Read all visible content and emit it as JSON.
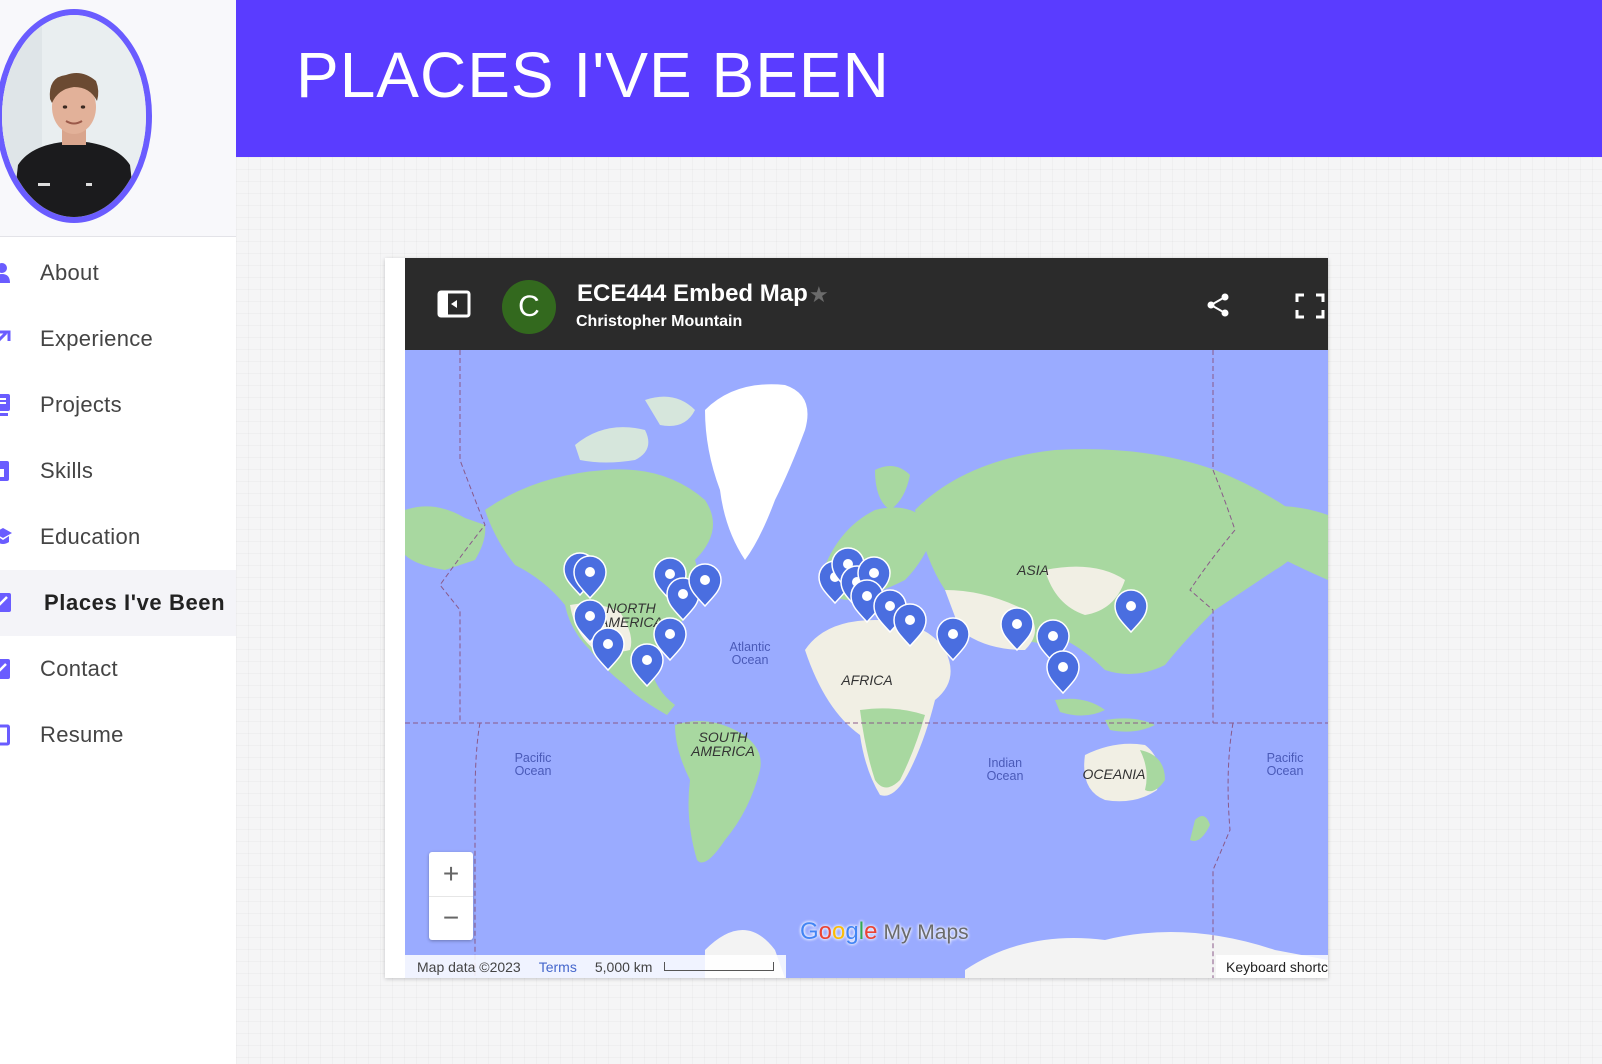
{
  "sidebar": {
    "items": [
      {
        "label": "About",
        "icon": "person-icon",
        "active": false
      },
      {
        "label": "Experience",
        "icon": "trending-up-icon",
        "active": false
      },
      {
        "label": "Projects",
        "icon": "monitor-icon",
        "active": false
      },
      {
        "label": "Skills",
        "icon": "chart-icon",
        "active": false
      },
      {
        "label": "Education",
        "icon": "graduation-cap-icon",
        "active": false
      },
      {
        "label": "Places I've Been",
        "icon": "plane-icon",
        "active": true
      },
      {
        "label": "Contact",
        "icon": "envelope-icon",
        "active": false
      },
      {
        "label": "Resume",
        "icon": "document-icon",
        "active": false
      }
    ]
  },
  "header": {
    "title": "PLACES I'VE BEEN"
  },
  "map": {
    "title": "ECE444 Embed Map",
    "owner": "Christopher Mountain",
    "owner_initial": "C",
    "labels": {
      "north_america": [
        "NORTH",
        "AMERICA"
      ],
      "south_america": [
        "SOUTH",
        "AMERICA"
      ],
      "africa": "AFRICA",
      "asia": "ASIA",
      "oceania": "OCEANIA",
      "atlantic": [
        "Atlantic",
        "Ocean"
      ],
      "pacific_w": [
        "Pacific",
        "Ocean"
      ],
      "pacific_e": [
        "Pacific",
        "Ocean"
      ],
      "indian": [
        "Indian",
        "Ocean"
      ]
    },
    "zoom_in": "+",
    "zoom_out": "−",
    "logo_google": "Google",
    "logo_mymaps": "My Maps",
    "attribution": "Map data ©2023",
    "terms": "Terms",
    "scale": "5,000 km",
    "keyboard": "Keyboard shortc"
  },
  "colors": {
    "accent": "#5a3cff",
    "avatar_ring": "#6a5cff",
    "ocean": "#9aabff",
    "land": "#a8d8a0",
    "desert": "#f1efe4",
    "pin": "#4a6ee0",
    "map_bar": "#2b2b2b",
    "owner_badge": "#33691e"
  }
}
